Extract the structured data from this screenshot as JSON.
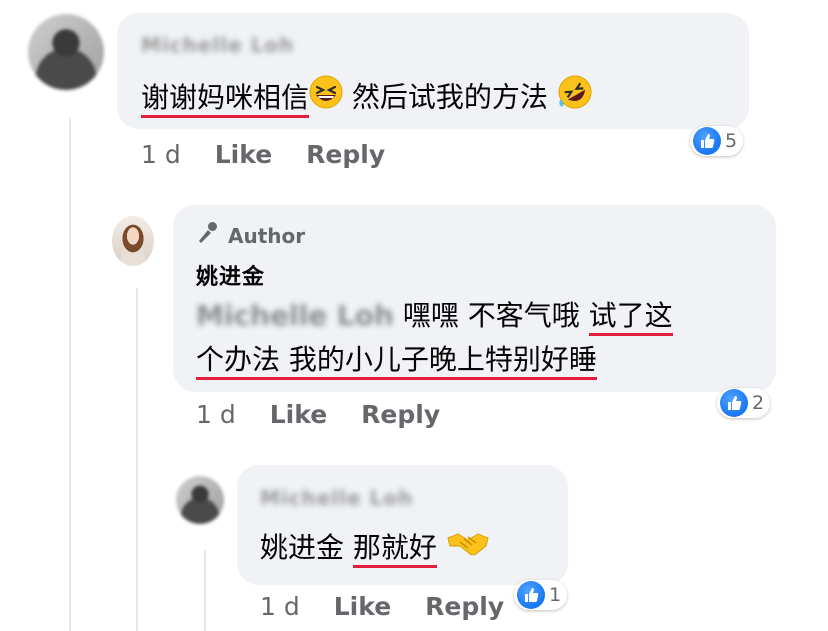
{
  "comments": [
    {
      "name": "Michelle Loh",
      "text_underlined": "谢谢妈咪相信",
      "text_rest": " 然后试我的方法 ",
      "time": "1 d",
      "like": "Like",
      "reply": "Reply",
      "reactions": "5"
    },
    {
      "author_badge": "Author",
      "name": "姚进金",
      "mention": "Michelle Loh",
      "line1_plain": " 嘿嘿 不客气哦 ",
      "line1_underlined": "试了这",
      "line2_underlined": "个办法 我的小儿子晚上特别好睡",
      "time": "1 d",
      "like": "Like",
      "reply": "Reply",
      "reactions": "2"
    },
    {
      "name": "Michelle Loh",
      "mention_text": "姚进金 ",
      "text_underlined": "那就好",
      "time": "1 d",
      "like": "Like",
      "reply": "Reply",
      "reactions": "1"
    }
  ],
  "icons": {
    "laughing": "grinning-squinting-face-icon",
    "rofl": "rolling-on-floor-laughing-icon",
    "handshake": "handshake-icon",
    "like": "thumbs-up-icon",
    "author": "microphone-icon"
  },
  "colors": {
    "bubble": "#f0f2f5",
    "underline": "#e41e3f",
    "like_blue": "#1877f2",
    "meta": "#65676b"
  }
}
